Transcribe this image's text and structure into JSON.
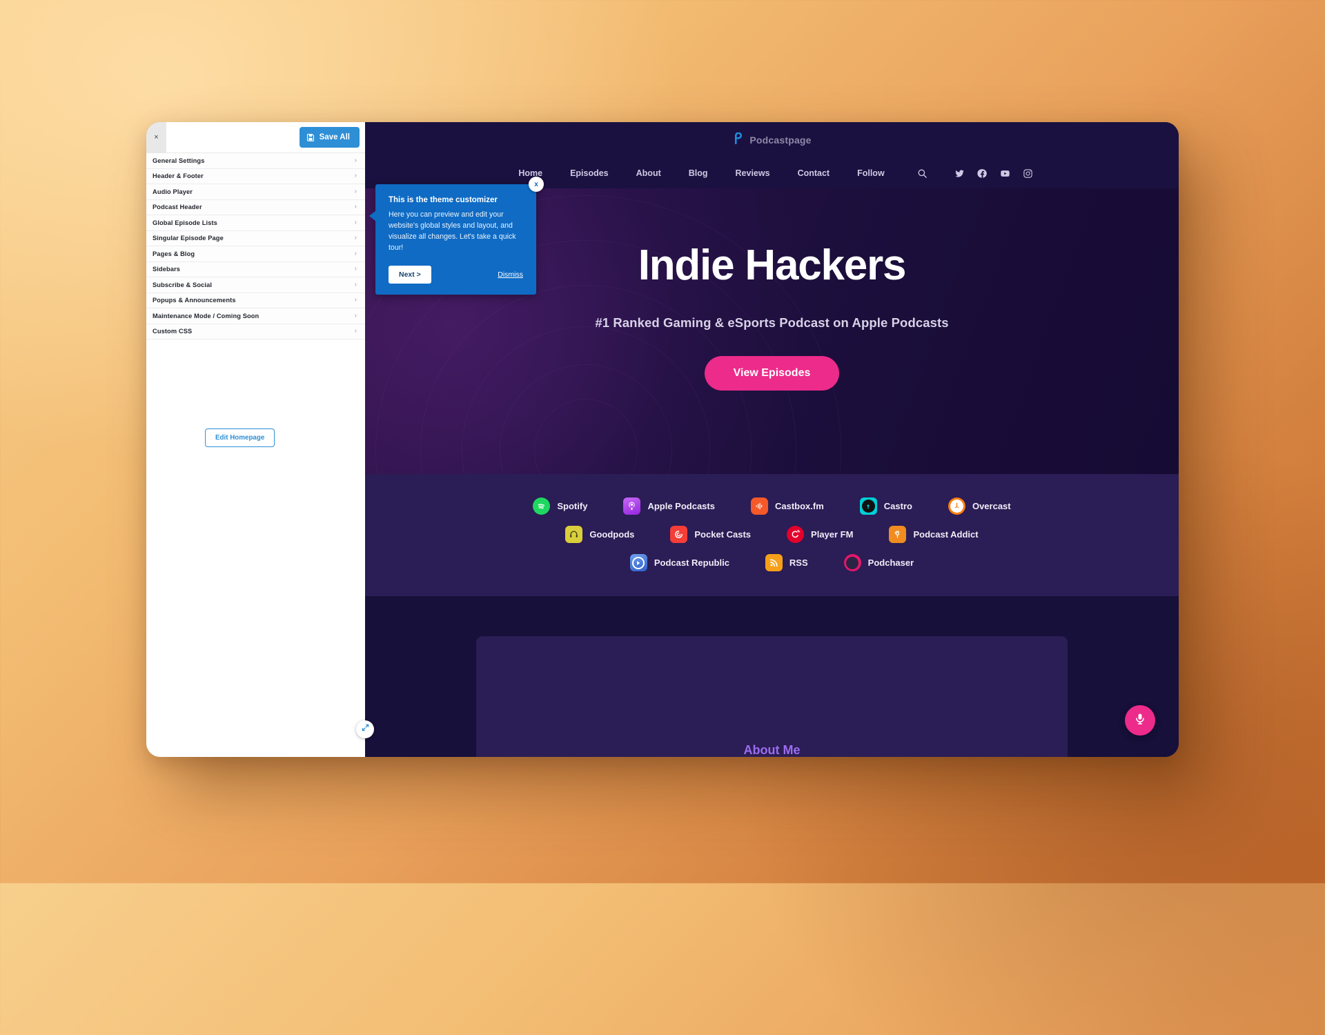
{
  "customizer": {
    "close_label": "×",
    "save_label": "Save All",
    "save_icon": "floppy-disk-icon",
    "edit_homepage_label": "Edit Homepage",
    "collapse_icon": "collapse-arrows-icon",
    "menu_items": [
      {
        "label": "General Settings",
        "chevron": "›"
      },
      {
        "label": "Header & Footer",
        "chevron": "›"
      },
      {
        "label": "Audio Player",
        "chevron": "›"
      },
      {
        "label": "Podcast Header",
        "chevron": "›"
      },
      {
        "label": "Global Episode Lists",
        "chevron": "›"
      },
      {
        "label": "Singular Episode Page",
        "chevron": "›"
      },
      {
        "label": "Pages & Blog",
        "chevron": "›"
      },
      {
        "label": "Sidebars",
        "chevron": "›"
      },
      {
        "label": "Subscribe & Social",
        "chevron": "›"
      },
      {
        "label": "Popups & Announcements",
        "chevron": "›"
      },
      {
        "label": "Maintenance Mode / Coming Soon",
        "chevron": "›"
      },
      {
        "label": "Custom CSS",
        "chevron": "›"
      }
    ]
  },
  "tour": {
    "title": "This is the theme customizer",
    "body": "Here you can preview and edit your website's global styles and layout, and visualize all changes. Let's take a quick tour!",
    "next_label": "Next >",
    "dismiss_label": "Dismiss",
    "close_label": "x"
  },
  "site": {
    "brand": {
      "name": "Podcastpage",
      "mark": "podcastpage-logo-icon"
    },
    "nav": [
      {
        "label": "Home"
      },
      {
        "label": "Episodes"
      },
      {
        "label": "About"
      },
      {
        "label": "Blog"
      },
      {
        "label": "Reviews"
      },
      {
        "label": "Contact"
      },
      {
        "label": "Follow"
      }
    ],
    "nav_icons": [
      {
        "name": "search-icon"
      },
      {
        "name": "twitter-icon"
      },
      {
        "name": "facebook-icon"
      },
      {
        "name": "youtube-icon"
      },
      {
        "name": "instagram-icon"
      }
    ],
    "hero": {
      "title": "Indie Hackers",
      "subtitle": "#1 Ranked Gaming & eSports Podcast on Apple Podcasts",
      "cta_label": "View Episodes"
    },
    "platform_rows": [
      [
        {
          "label": "Spotify",
          "icon": "spotify-icon",
          "color": "#1ED760",
          "shape": "round"
        },
        {
          "label": "Apple Podcasts",
          "icon": "apple-podcasts-icon",
          "color": "#A240E8",
          "shape": "rounded"
        },
        {
          "label": "Castbox.fm",
          "icon": "castbox-icon",
          "color": "#F5592A",
          "shape": "hex"
        },
        {
          "label": "Castro",
          "icon": "castro-icon",
          "color": "#00D0D6",
          "shape": "rounded"
        },
        {
          "label": "Overcast",
          "icon": "overcast-icon",
          "color": "#FC7E0F",
          "shape": "rounded"
        }
      ],
      [
        {
          "label": "Goodpods",
          "icon": "goodpods-icon",
          "color": "#D9CE3B",
          "shape": "rounded"
        },
        {
          "label": "Pocket Casts",
          "icon": "pocket-casts-icon",
          "color": "#F43E37",
          "shape": "rounded"
        },
        {
          "label": "Player FM",
          "icon": "player-fm-icon",
          "color": "#E3002B",
          "shape": "round"
        },
        {
          "label": "Podcast Addict",
          "icon": "podcast-addict-icon",
          "color": "#F08C20",
          "shape": "rounded"
        }
      ],
      [
        {
          "label": "Podcast Republic",
          "icon": "podcast-republic-icon",
          "color": "#4A7FE0",
          "shape": "rounded"
        },
        {
          "label": "RSS",
          "icon": "rss-icon",
          "color": "#F6A01A",
          "shape": "rounded"
        },
        {
          "label": "Podchaser",
          "icon": "podchaser-icon",
          "color": "#E5176B",
          "shape": "round"
        }
      ]
    ],
    "about": {
      "title": "About Me"
    },
    "mic_fab": {
      "icon": "microphone-icon",
      "color": "#EC2B8A"
    }
  }
}
